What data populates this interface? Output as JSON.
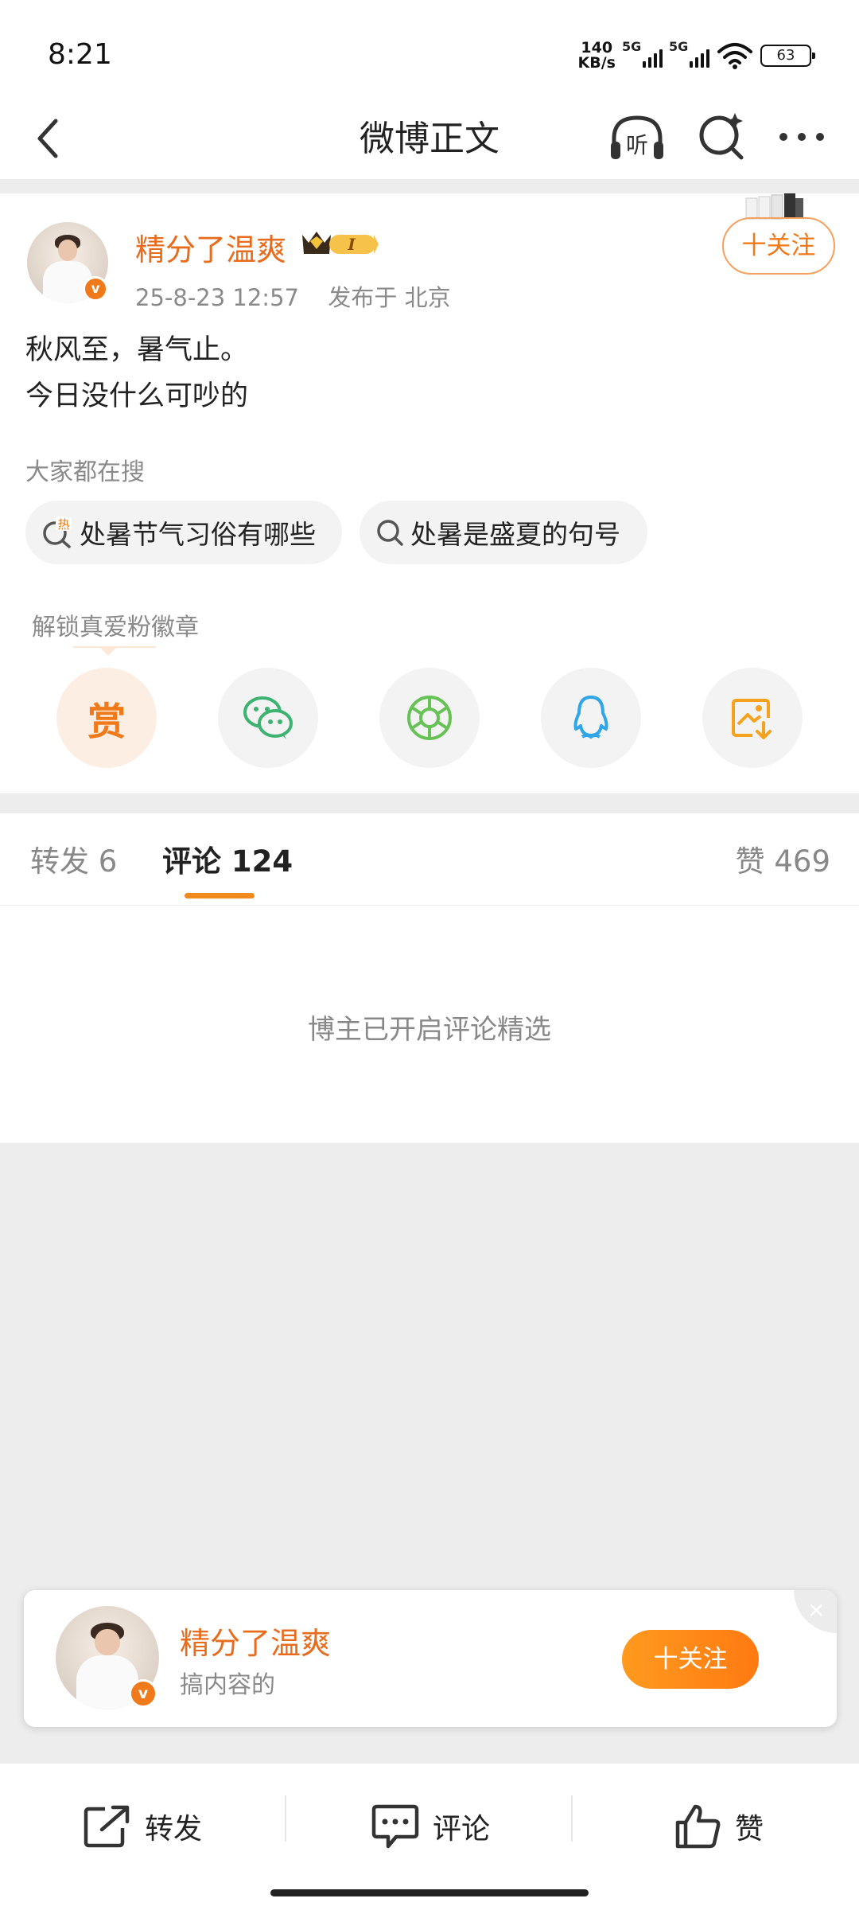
{
  "status_bar": {
    "time": "8:21",
    "net_speed_value": "140",
    "net_speed_unit": "KB/s",
    "sim1": "5G",
    "sim2": "5G",
    "battery": "63"
  },
  "nav": {
    "title": "微博正文",
    "listen_label": "听"
  },
  "post": {
    "author": "精分了温爽",
    "level_badge": "I",
    "date": "25-8-23 12:57",
    "location": "发布于 北京",
    "follow_label": "十关注",
    "text_lines": [
      "秋风至，暑气止。",
      "今日没什么可吵的"
    ]
  },
  "hot_search": {
    "label": "大家都在搜",
    "hot_tag": "热",
    "items": [
      "处暑节气习俗有哪些",
      "处暑是盛夏的句号"
    ]
  },
  "fan_badge": {
    "label": "解锁真爱粉徽章",
    "reward_label": "赏"
  },
  "tabs": {
    "repost": "转发 6",
    "comment": "评论 124",
    "like": "赞 469"
  },
  "comments": {
    "notice": "博主已开启评论精选"
  },
  "popup": {
    "name": "精分了温爽",
    "desc": "搞内容的",
    "follow_label": "十关注",
    "close": "×"
  },
  "bottom_bar": {
    "repost": "转发",
    "comment": "评论",
    "like": "赞"
  },
  "colors": {
    "accent": "#f07a1a",
    "author": "#e86c1e",
    "tab_indicator": "#f08c1e"
  }
}
